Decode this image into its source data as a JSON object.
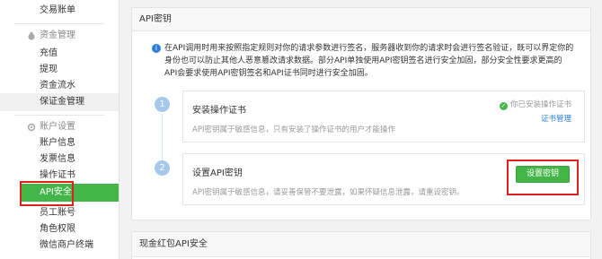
{
  "sidebar": {
    "top_item": "交易账单",
    "groups": [
      {
        "label": "资金管理",
        "icon": "money-bag-icon",
        "items": [
          "充值",
          "提现",
          "资金流水",
          "保证金管理"
        ]
      },
      {
        "label": "账户设置",
        "icon": "gear-icon",
        "items": [
          "账户信息",
          "发票信息",
          "操作证书",
          "API安全",
          "员工账号",
          "角色权限",
          "微信商户终端"
        ]
      }
    ],
    "active_item": "API安全"
  },
  "main": {
    "panel_title": "API密钥",
    "notice": "在API调用时用来按照指定规则对你的请求参数进行签名，服务器收到你的请求时会进行签名验证，既可以界定你的身份也可以防止其他人恶意篡改请求数据。部分API单独使用API密钥签名进行安全加固，部分安全性要求更高的API会要求使用API密钥签名和API证书同时进行安全加固。",
    "steps": [
      {
        "number": "1",
        "title": "安装操作证书",
        "description": "API密钥属于敏感信息，只有安装了操作证书的用户才能操作",
        "status": "你已安装操作证书",
        "link": "证书管理"
      },
      {
        "number": "2",
        "title": "设置API密钥",
        "description": "API密钥属于敏感信息，请妥善保管不要泄露，如果怀疑信息泄露，请重设密钥。",
        "button": "设置密钥"
      }
    ],
    "section2_title": "现金红包API安全"
  },
  "colors": {
    "accent_green": "#44b549",
    "link_blue": "#2e7fd8",
    "annotation_red": "#e01f1f"
  }
}
